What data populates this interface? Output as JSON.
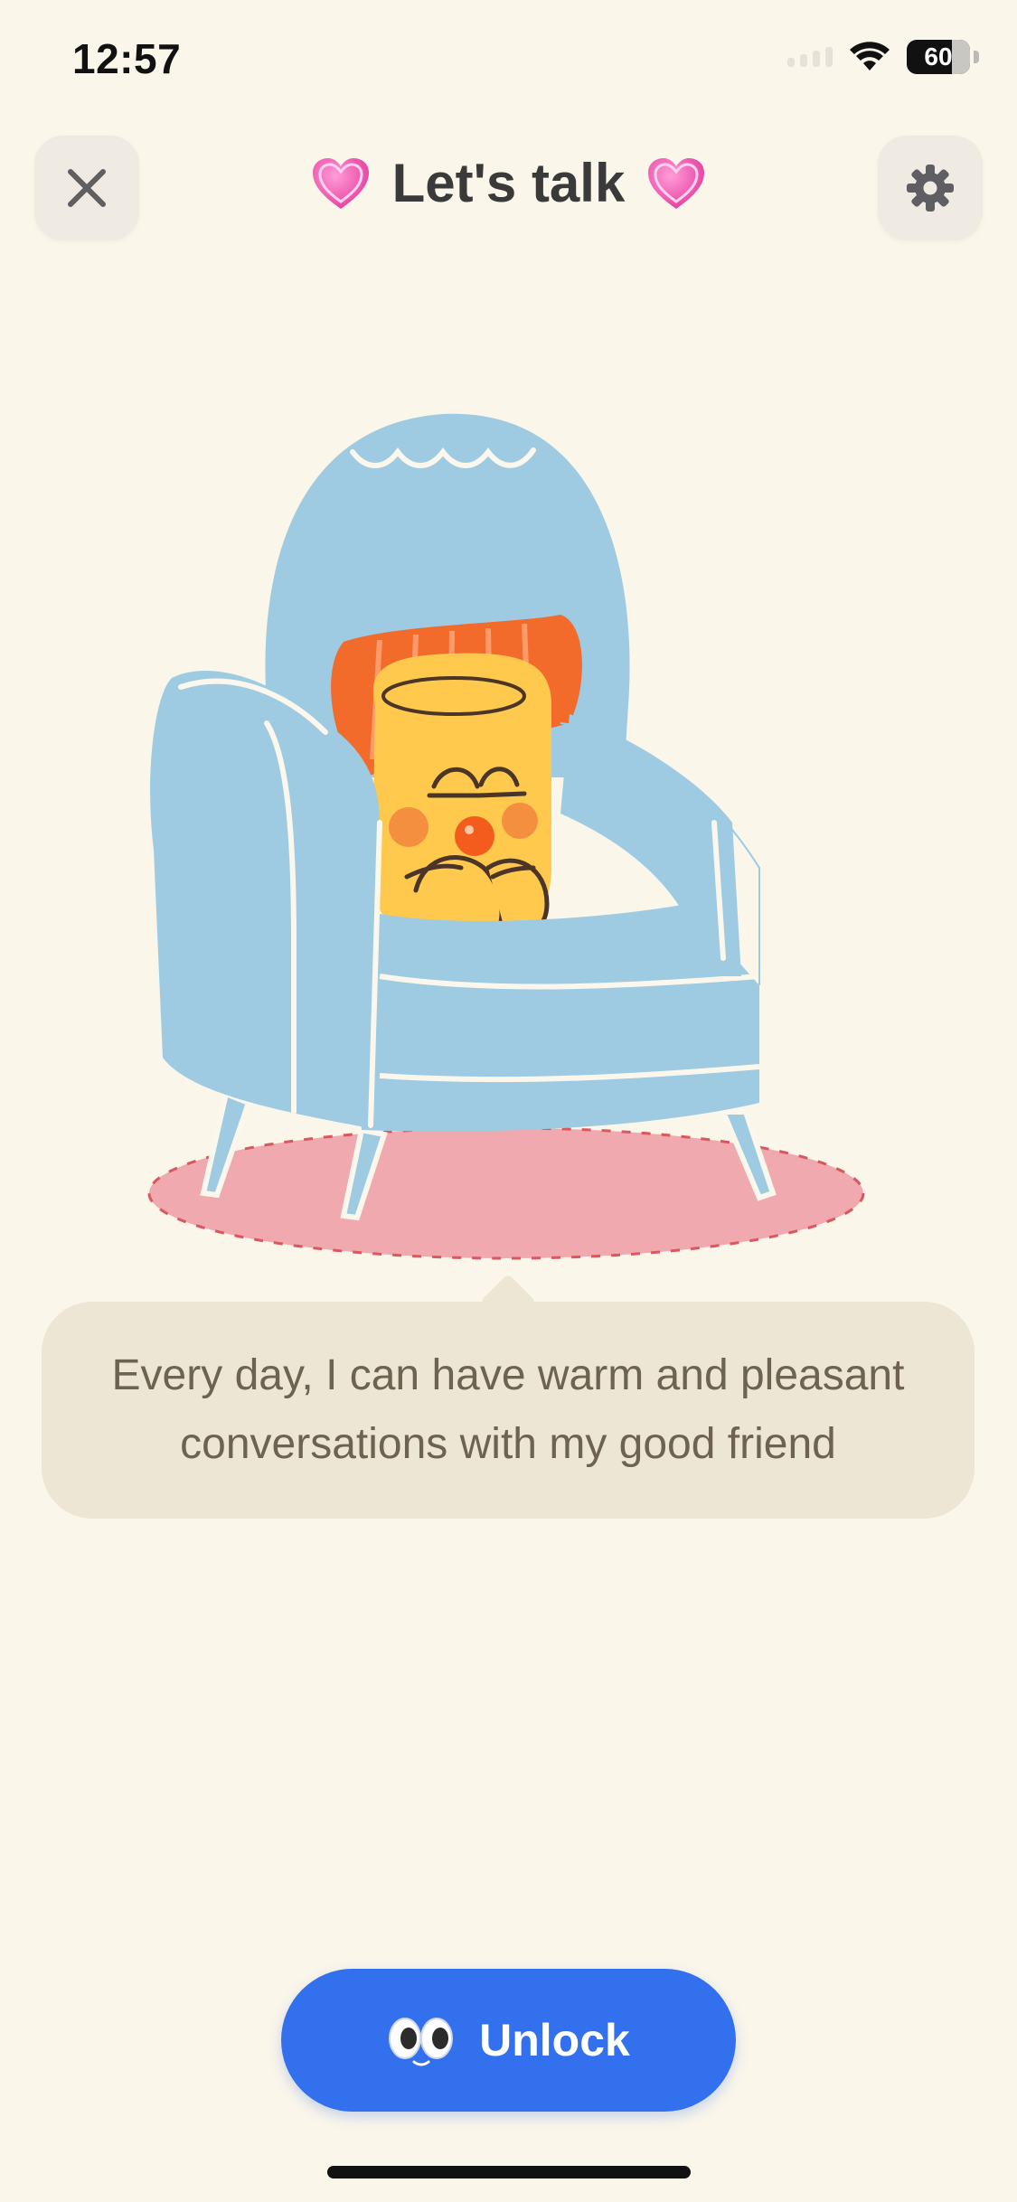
{
  "status_bar": {
    "time": "12:57",
    "battery": "60"
  },
  "header": {
    "title": "Let's talk",
    "title_emoji": "heart-emoji"
  },
  "bubble": {
    "line1": "Every day, I can have warm and pleasant",
    "line2": "conversations with my good friend"
  },
  "unlock_button": {
    "label": "Unlock",
    "icon": "eyes-icon"
  },
  "colors": {
    "background": "#FAF6EA",
    "bubble": "#EDE6D4",
    "accent": "#3370EE",
    "chair": "#9ECBE1",
    "rug": "#F0A9AF",
    "pillow": "#F26B2B",
    "character": "#FFC94D"
  }
}
